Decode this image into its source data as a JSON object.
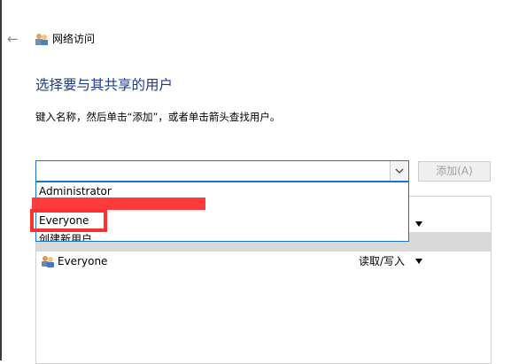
{
  "window": {
    "title": "网络访问",
    "back_icon": "back-arrow-icon",
    "title_icon": "network-users-icon"
  },
  "heading": "选择要与其共享的用户",
  "instruction": "键入名称，然后单击“添加”，或者单击箭头查找用户。",
  "combo": {
    "value": "",
    "dropdown_icon": "chevron-down-icon"
  },
  "add_button": {
    "label": "添加(A)",
    "enabled": false
  },
  "dropdown_options": [
    "Administrator",
    "Everyone",
    "创建新用户..."
  ],
  "table": {
    "rows": [
      {
        "name": "",
        "permission": ""
      },
      {
        "name": "",
        "permission": ""
      },
      {
        "name": "Everyone",
        "permission": "读取/写入"
      }
    ]
  },
  "colors": {
    "accent": "#1a73d6",
    "heading": "#1e3a8a",
    "highlight": "#ff3030",
    "selected_row": "#d9d9d9"
  }
}
